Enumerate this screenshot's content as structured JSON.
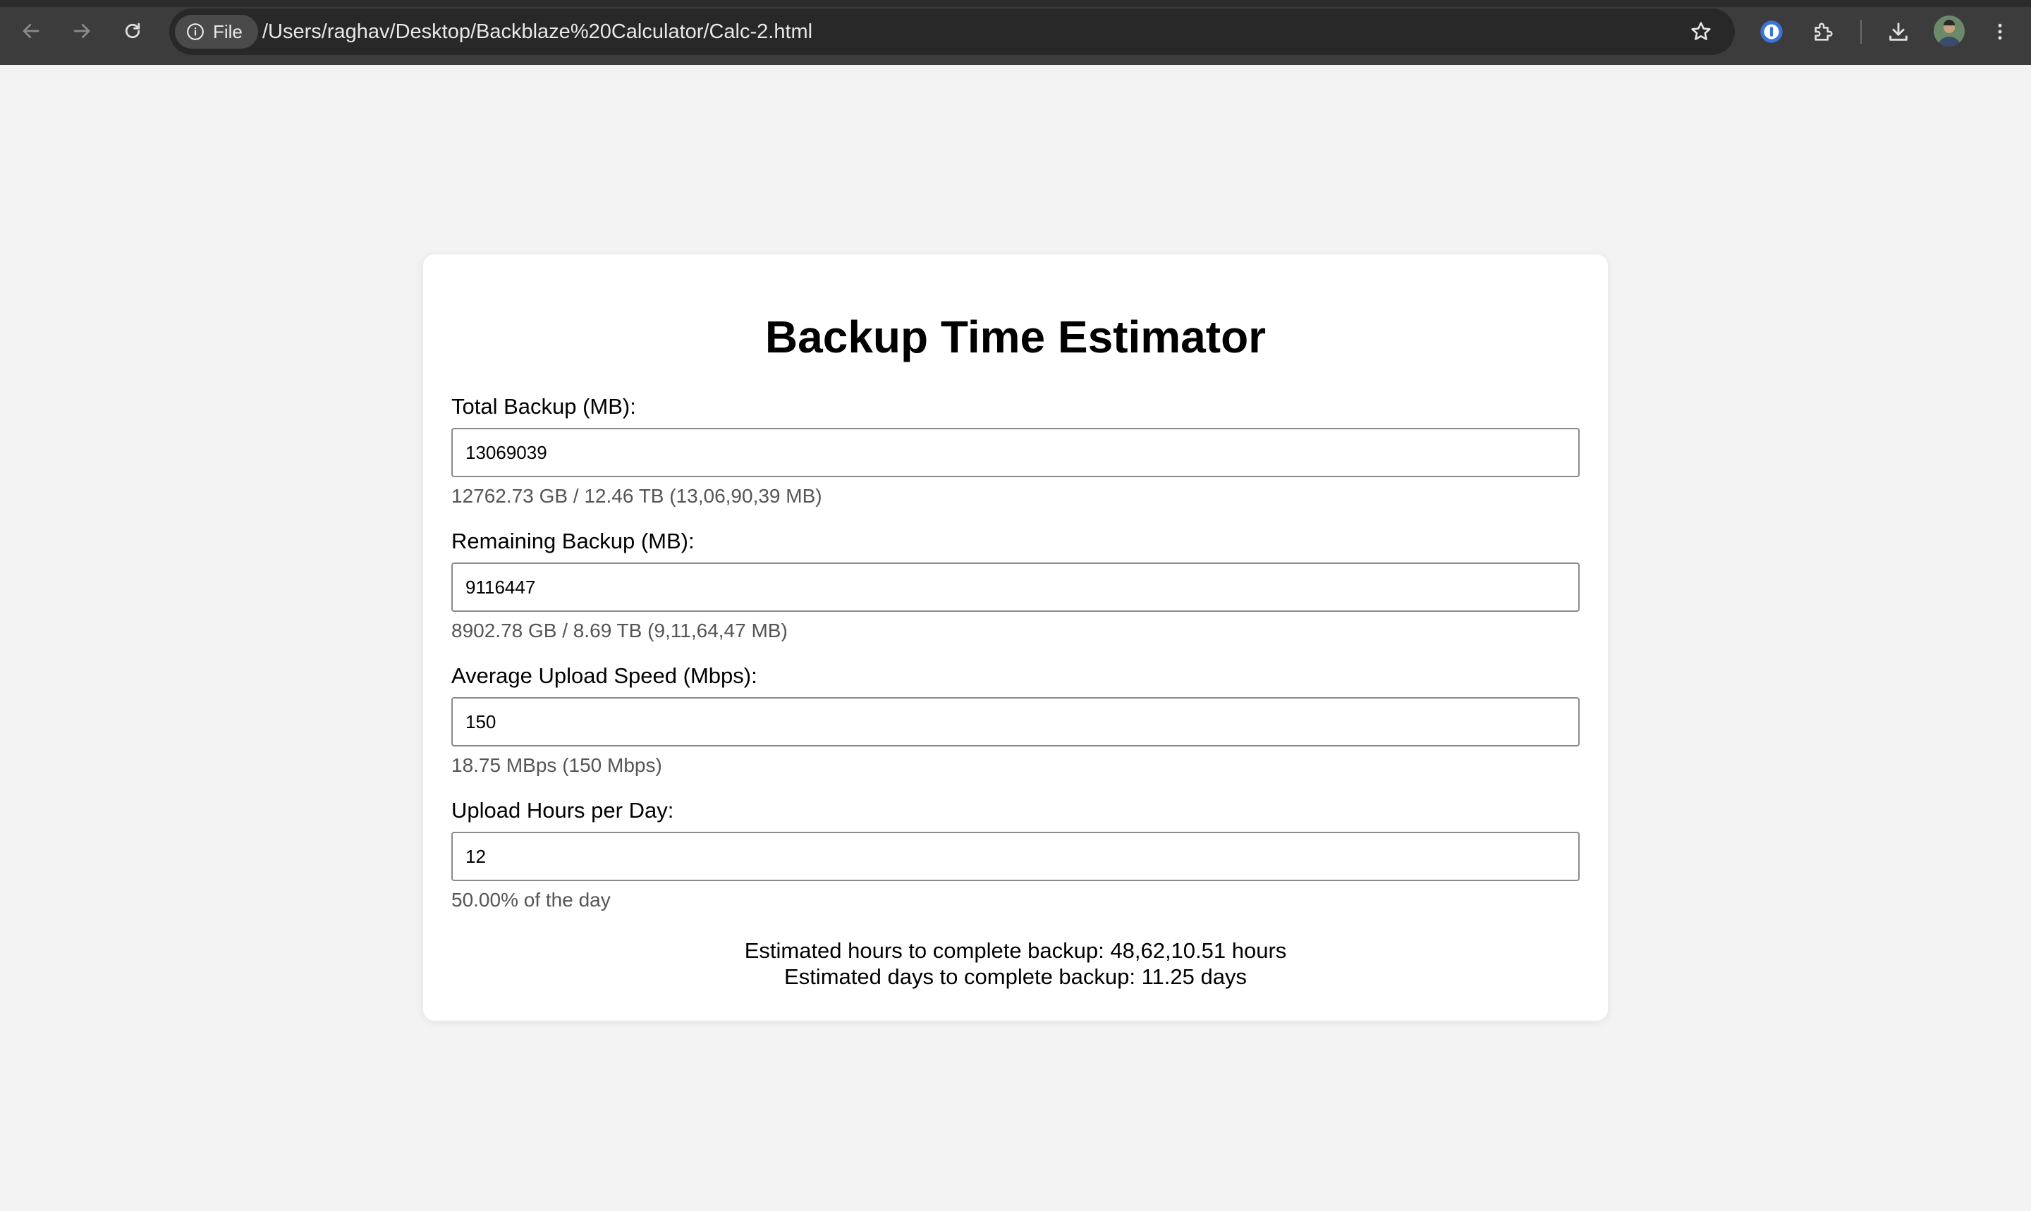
{
  "browser": {
    "file_chip_label": "File",
    "url": "/Users/raghav/Desktop/Backblaze%20Calculator/Calc-2.html"
  },
  "page": {
    "title": "Backup Time Estimator",
    "fields": [
      {
        "label": "Total Backup (MB):",
        "value": "13069039",
        "note": "12762.73 GB / 12.46 TB (13,06,90,39 MB)"
      },
      {
        "label": "Remaining Backup (MB):",
        "value": "9116447",
        "note": "8902.78 GB / 8.69 TB (9,11,64,47 MB)"
      },
      {
        "label": "Average Upload Speed (Mbps):",
        "value": "150",
        "note": "18.75 MBps (150 Mbps)"
      },
      {
        "label": "Upload Hours per Day:",
        "value": "12",
        "note": "50.00% of the day"
      }
    ],
    "results": {
      "hours": "Estimated hours to complete backup: 48,62,10.51 hours",
      "days": "Estimated days to complete backup: 11.25 days"
    }
  },
  "colors": {
    "page_background": "#f3f3f3",
    "card_background": "#ffffff",
    "chrome_background": "#3c3c3c",
    "omnibox_background": "#282828",
    "note_text": "#555555"
  },
  "icons": {
    "back": "arrow-left-icon",
    "forward": "arrow-right-icon",
    "reload": "reload-icon",
    "site_info": "info-icon",
    "bookmark": "star-icon",
    "password_manager": "password-manager-icon",
    "extensions": "puzzle-icon",
    "downloads": "download-icon",
    "profile": "avatar",
    "menu": "kebab-menu-icon"
  }
}
